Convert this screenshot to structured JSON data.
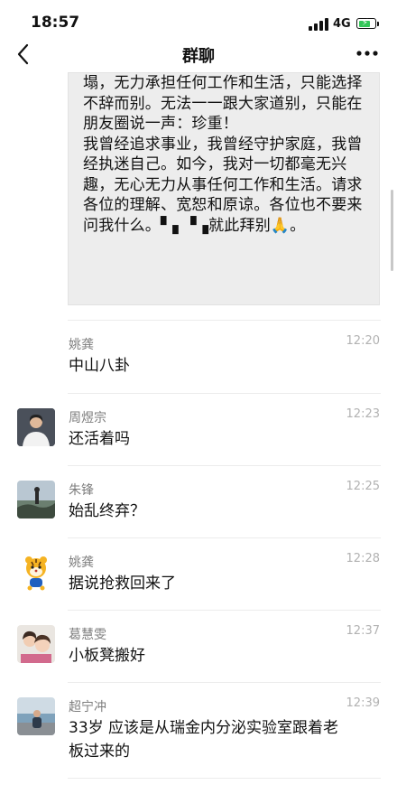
{
  "status_bar": {
    "time": "18:57",
    "network": "4G",
    "battery_level": 0.75,
    "signal_bars": 4,
    "accent_color": "#34c759"
  },
  "nav": {
    "title": "群聊",
    "back_icon": "chevron-left-icon",
    "more_icon": "more-horizontal-icon"
  },
  "article": {
    "lines": [
      "塌，无力承担任何工作和生活，只能选择",
      "不辞而别。无法一一跟大家道别，只能在",
      "朋友圈说一声：珍重！",
      "我曾经追求事业，我曾经守护家庭，我曾",
      "经执迷自己。如今，我对一切都毫无兴",
      "趣，无心无力从事任何工作和生活。请求",
      "各位的理解、宽恕和原谅。各位也不要来",
      "问我什么。▘▖▝▗就此拜别🙏。"
    ]
  },
  "comments": [
    {
      "name": "姚龚",
      "time": "12:20",
      "text": [
        "中山八卦"
      ],
      "avatar": "none"
    },
    {
      "name": "周煜宗",
      "time": "12:23",
      "text": [
        "还活着吗"
      ],
      "avatar": "person-portrait"
    },
    {
      "name": "朱锋",
      "time": "12:25",
      "text": [
        "始乱终弃？"
      ],
      "avatar": "landscape-photo"
    },
    {
      "name": "姚龚",
      "time": "12:28",
      "text": [
        "据说抢救回来了"
      ],
      "avatar": "cartoon-tiger"
    },
    {
      "name": "葛慧雯",
      "time": "12:37",
      "text": [
        "小板凳搬好"
      ],
      "avatar": "family-photo"
    },
    {
      "name": "超宁冲",
      "time": "12:39",
      "text": [
        "33岁 应该是从瑞金内分泌实验室跟着老",
        "板过来的"
      ],
      "avatar": "seaside-photo"
    }
  ]
}
